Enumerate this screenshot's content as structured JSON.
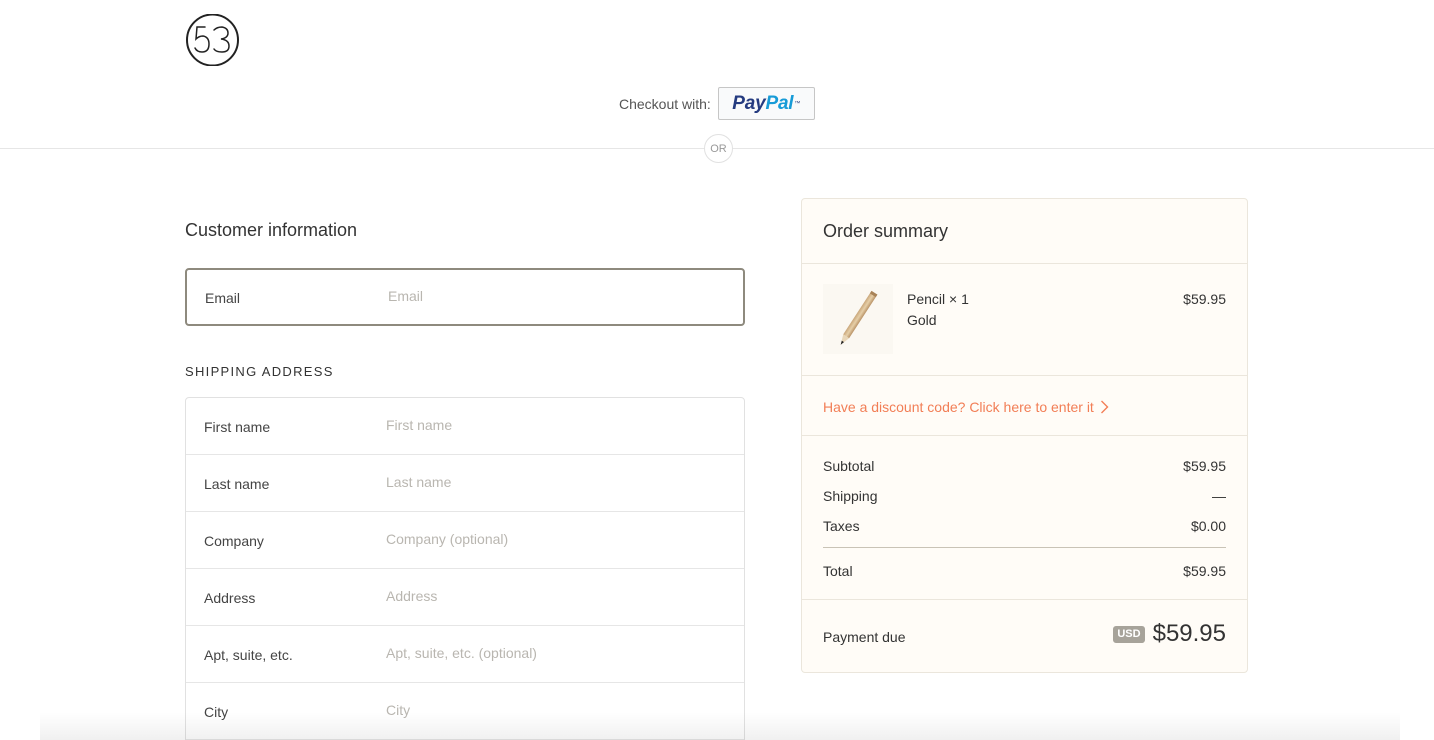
{
  "logo": {
    "text": "53"
  },
  "express_checkout": {
    "label": "Checkout with:",
    "paypal_pay": "Pay",
    "paypal_pal": "Pal",
    "paypal_tm": "™"
  },
  "divider": {
    "or_label": "OR"
  },
  "customer": {
    "title": "Customer information",
    "email": {
      "label": "Email",
      "value": "",
      "placeholder": "Email"
    }
  },
  "shipping": {
    "heading": "SHIPPING ADDRESS",
    "fields": [
      {
        "label": "First name",
        "placeholder": "First name",
        "value": ""
      },
      {
        "label": "Last name",
        "placeholder": "Last name",
        "value": ""
      },
      {
        "label": "Company",
        "placeholder": "Company (optional)",
        "value": ""
      },
      {
        "label": "Address",
        "placeholder": "Address",
        "value": ""
      },
      {
        "label": "Apt, suite, etc.",
        "placeholder": "Apt, suite, etc. (optional)",
        "value": ""
      },
      {
        "label": "City",
        "placeholder": "City",
        "value": ""
      }
    ]
  },
  "summary": {
    "title": "Order summary",
    "product": {
      "name": "Pencil × 1",
      "variant": "Gold",
      "price": "$59.95",
      "image_icon": "pencil-product-icon"
    },
    "discount_link": "Have a discount code? Click here to enter it",
    "subtotal": {
      "label": "Subtotal",
      "value": "$59.95"
    },
    "shipping": {
      "label": "Shipping",
      "value": "—"
    },
    "taxes": {
      "label": "Taxes",
      "value": "$0.00"
    },
    "total": {
      "label": "Total",
      "value": "$59.95"
    },
    "payment_due": {
      "label": "Payment due",
      "currency": "USD",
      "amount": "$59.95"
    }
  },
  "colors": {
    "accent_link": "#f27e56",
    "summary_bg": "#fffcf7",
    "paypal_dark": "#253b80",
    "paypal_light": "#179bd7"
  }
}
